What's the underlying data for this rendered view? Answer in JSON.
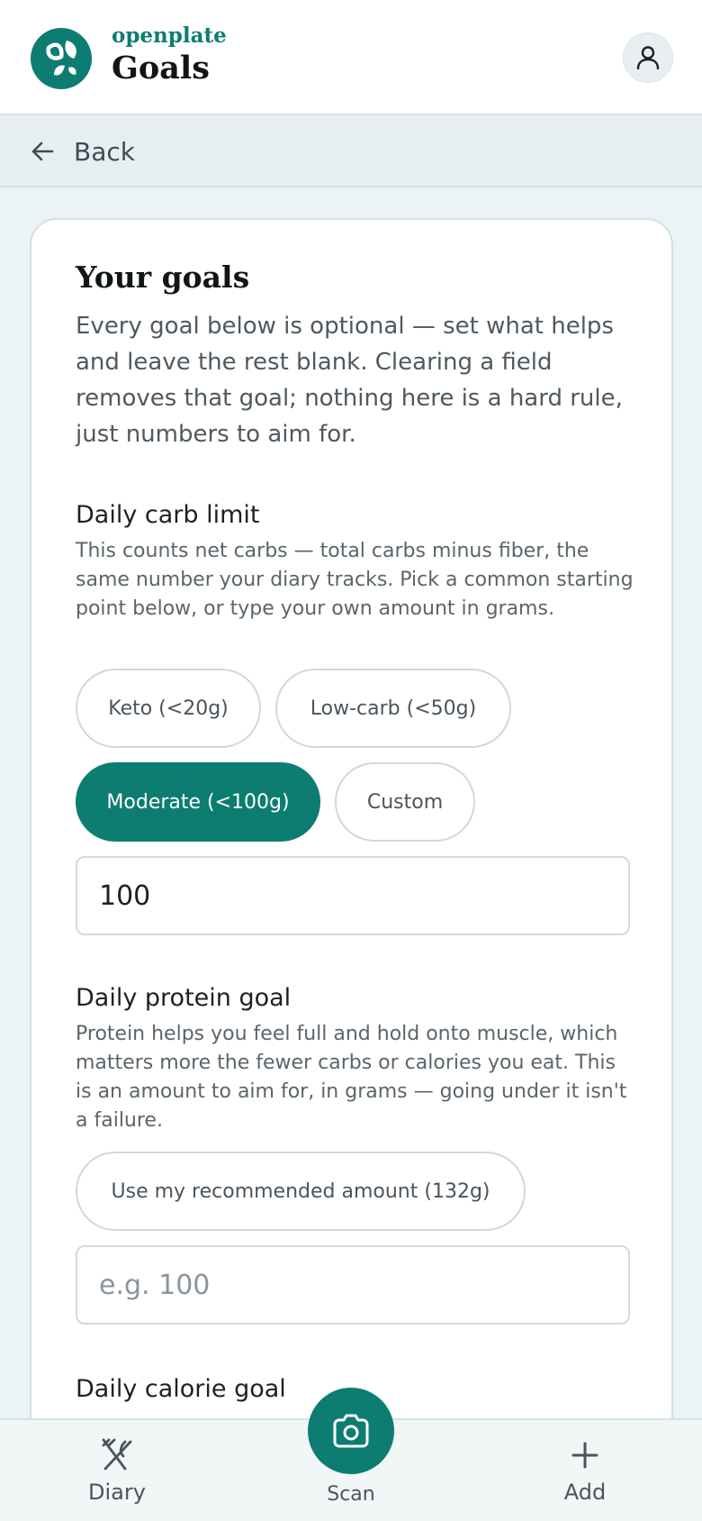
{
  "header": {
    "brand": "openplate",
    "title": "Goals"
  },
  "backbar": {
    "back_label": "Back"
  },
  "card": {
    "title": "Your goals",
    "intro": "Every goal below is optional — set what helps and leave the rest blank. Clearing a field removes that goal; nothing here is a hard rule, just numbers to aim for."
  },
  "carb": {
    "title": "Daily carb limit",
    "description": "This counts net carbs — total carbs minus fiber, the same number your diary tracks. Pick a common starting point below, or type your own amount in grams.",
    "presets": [
      {
        "label": "Keto (<20g)",
        "selected": false
      },
      {
        "label": "Low-carb (<50g)",
        "selected": false
      },
      {
        "label": "Moderate (<100g)",
        "selected": true
      },
      {
        "label": "Custom",
        "selected": false
      }
    ],
    "value": "100"
  },
  "protein": {
    "title": "Daily protein goal",
    "description": "Protein helps you feel full and hold onto muscle, which matters more the fewer carbs or calories you eat. This is an amount to aim for, in grams — going under it isn't a failure.",
    "recommend_label": "Use my recommended amount (132g)",
    "value": "",
    "placeholder": "e.g. 100"
  },
  "calorie": {
    "title": "Daily calorie goal"
  },
  "nav": {
    "diary_label": "Diary",
    "scan_label": "Scan",
    "add_label": "Add"
  },
  "colors": {
    "accent": "#0d7d72",
    "background": "#ecf3f5"
  }
}
